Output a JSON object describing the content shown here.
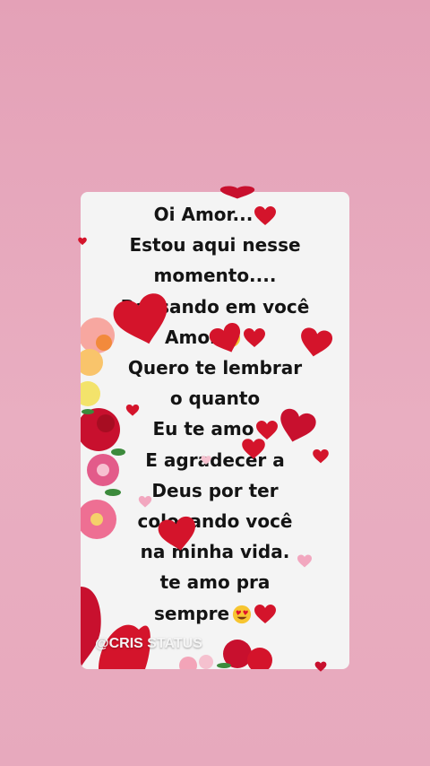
{
  "message": {
    "lines": [
      "Oi Amor...",
      "Estou aqui nesse",
      "momento....",
      "Pensando em você",
      "Amor",
      "Quero te lembrar",
      "o quanto",
      "Eu te amo",
      "E agradecer a",
      "Deus por ter",
      "colocando você",
      "na minha vida.",
      "te amo pra",
      "sempre"
    ]
  },
  "watermark": "@CRIS STATUS",
  "colors": {
    "background": "#e6a6bb",
    "card": "#f4f4f4",
    "heart": "#d4142b",
    "text": "#141414"
  },
  "icons": [
    "red-heart-emoji",
    "heart-eyes-emoji"
  ]
}
